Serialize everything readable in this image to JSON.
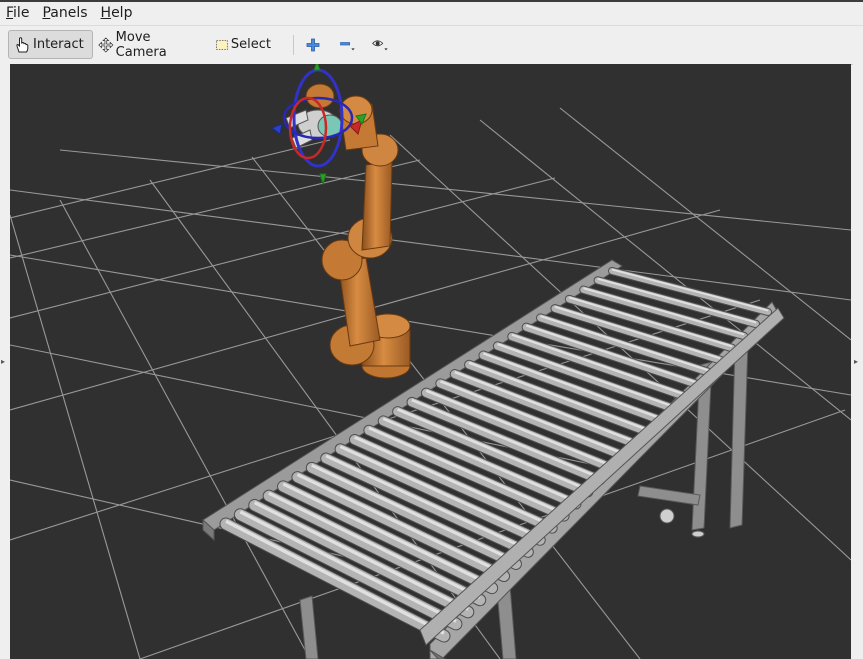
{
  "menu": {
    "file": {
      "mnemonic": "F",
      "rest": "ile"
    },
    "panels": {
      "mnemonic": "P",
      "rest": "anels"
    },
    "help": {
      "mnemonic": "H",
      "rest": "elp"
    }
  },
  "toolbar": {
    "interact_label": "Interact",
    "move_camera_label": "Move Camera",
    "select_label": "Select"
  },
  "icons": {
    "interact": "hand-pointer-icon",
    "move_camera": "move-arrows-icon",
    "select": "selection-box-icon",
    "add": "plus-icon",
    "remove": "minus-icon",
    "view": "eye-icon",
    "left_collapse": "triangle-left-icon",
    "right_collapse": "triangle-right-icon"
  },
  "colors": {
    "viewport_bg": "#303030",
    "grid": "#a0a0a0",
    "robot_orange": "#c77a32",
    "conveyor_gray": "#9a9a9a",
    "accent_blue": "#2f6fcf"
  }
}
